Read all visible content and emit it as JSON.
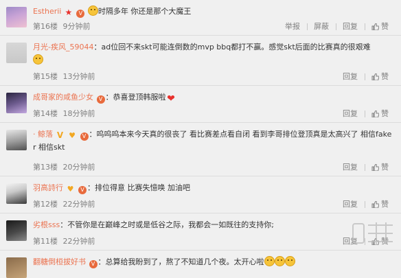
{
  "comments": [
    {
      "username": "Estherii",
      "badges": [
        "star",
        "lv"
      ],
      "text": "时隔多年 你还是那个大魔王",
      "prefix_emoji": true,
      "floor": "第16楼",
      "time": "9分钟前",
      "actions": [
        "举报",
        "屏蔽",
        "回复"
      ],
      "likes": "赞"
    },
    {
      "username": "月光-疾风_59044",
      "badges": [],
      "text": "：ad位回不来skt可能连倒数的mvp bbq都打不赢。感觉skt后面的比赛真的很艰难",
      "suffix_emoji": true,
      "floor": "第15楼",
      "time": "13分钟前",
      "actions": [
        "回复"
      ],
      "likes": "赞"
    },
    {
      "username": "成哥家的咸鱼少女",
      "badges": [
        "lv"
      ],
      "text": "：恭喜登顶韩服啦",
      "heart_emoji": true,
      "floor": "第14楼",
      "time": "18分钟前",
      "actions": [
        "回复"
      ],
      "likes": "赞"
    },
    {
      "username": "· 鲸落",
      "badges": [
        "v",
        "heart",
        "lv"
      ],
      "text": "：呜呜呜本来今天真的很丧了 看比赛差点看自闭 看到李哥排位登顶真是太高兴了 相信faker 相信skt",
      "floor": "第13楼",
      "time": "20分钟前",
      "actions": [
        "回复"
      ],
      "likes": "赞"
    },
    {
      "username": "羽高詩行",
      "badges": [
        "heart",
        "lv"
      ],
      "text": "：排位得意 比赛失憶唤 加油吧",
      "floor": "第12楼",
      "time": "22分钟前",
      "actions": [
        "回复"
      ],
      "likes": "赞"
    },
    {
      "username": "劣根sss",
      "badges": [],
      "text": "：不管你是在巅峰之时或是低谷之际，我都会一如既往的支持你;",
      "floor": "第11楼",
      "time": "22分钟前",
      "actions": [
        "回复"
      ],
      "likes": "赞"
    },
    {
      "username": "翻糖倒桓拔好书",
      "badges": [
        "lv"
      ],
      "text": "：总算给我盼到了，熬了不知道几个夜。太开心啦",
      "triple_emoji": true,
      "floor": "",
      "time": "",
      "actions": [],
      "likes": ""
    }
  ],
  "colors": {
    "username": "#eb7350",
    "meta": "#808080",
    "background": "#f0f0f0",
    "divider": "#dcdcdc"
  }
}
